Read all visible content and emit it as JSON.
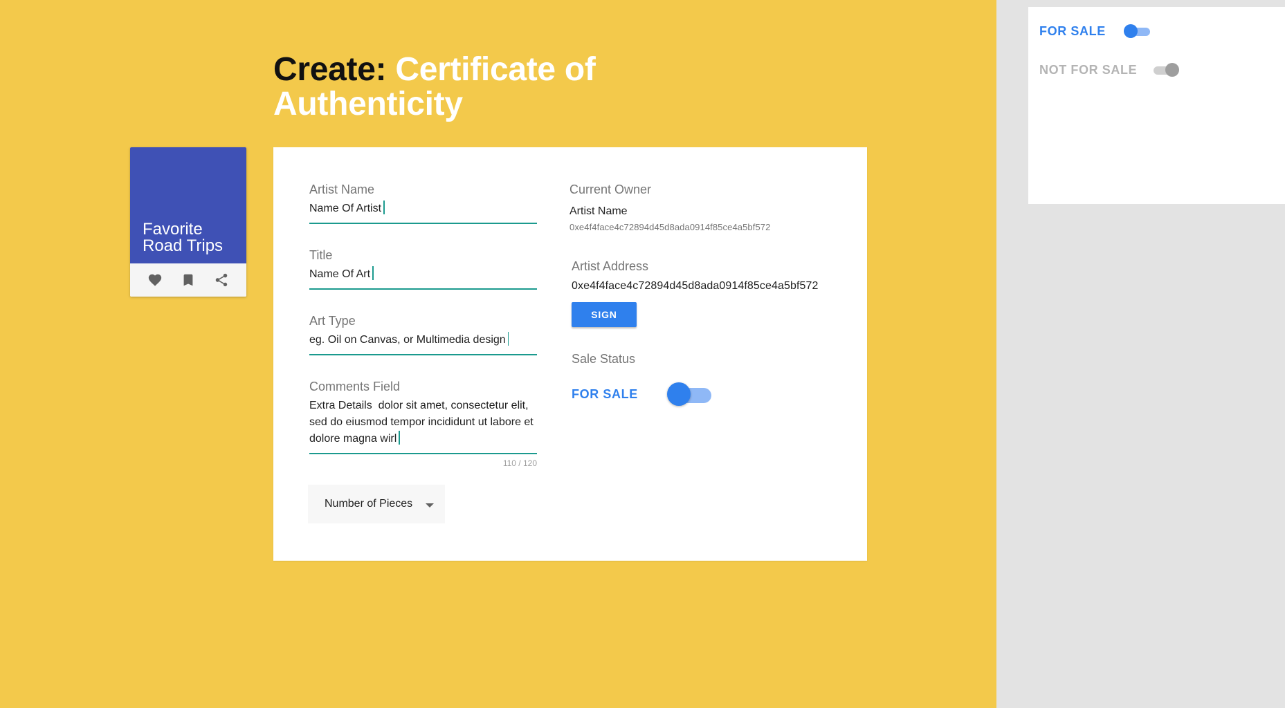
{
  "header": {
    "title_prefix": "Create:",
    "title_accent": "Certificate of Authenticity"
  },
  "side_card": {
    "title": "Favorite Road Trips",
    "actions": [
      {
        "icon": "heart-icon"
      },
      {
        "icon": "bookmark-icon"
      },
      {
        "icon": "share-icon"
      }
    ],
    "media_color": "#3f51b5"
  },
  "form": {
    "artist_name": {
      "label": "Artist Name",
      "value": "Name Of Artist"
    },
    "title": {
      "label": "Title",
      "value": "Name Of Art"
    },
    "art_type": {
      "label": "Art Type",
      "value": "eg. Oil on Canvas, or Multimedia design"
    },
    "comments": {
      "label": "Comments Field",
      "value": "Extra Details  dolor sit amet, consectetur elit, sed do eiusmod tempor incididunt ut labore et dolore magna wirl",
      "counter": "110 / 120"
    },
    "pieces_select": {
      "label": "Number of Pieces"
    }
  },
  "owner": {
    "label": "Current Owner",
    "name": "Artist Name",
    "hash": "0xe4f4face4c72894d45d8ada0914f85ce4a5bf572"
  },
  "artist_address": {
    "label": "Artist Address",
    "value": "0xe4f4face4c72894d45d8ada0914f85ce4a5bf572"
  },
  "sign_button": {
    "label": "SIGN"
  },
  "sale_status": {
    "label": "Sale Status",
    "state_label": "FOR SALE",
    "toggle_on": true
  },
  "toggle_examples": [
    {
      "label": "FOR SALE",
      "on": true
    },
    {
      "label": "NOT FOR SALE",
      "on": false
    }
  ],
  "colors": {
    "background": "#f3c94b",
    "accent": "#2f80ed",
    "field_underline": "#1b9a8e",
    "side_panel": "#e3e3e3"
  }
}
